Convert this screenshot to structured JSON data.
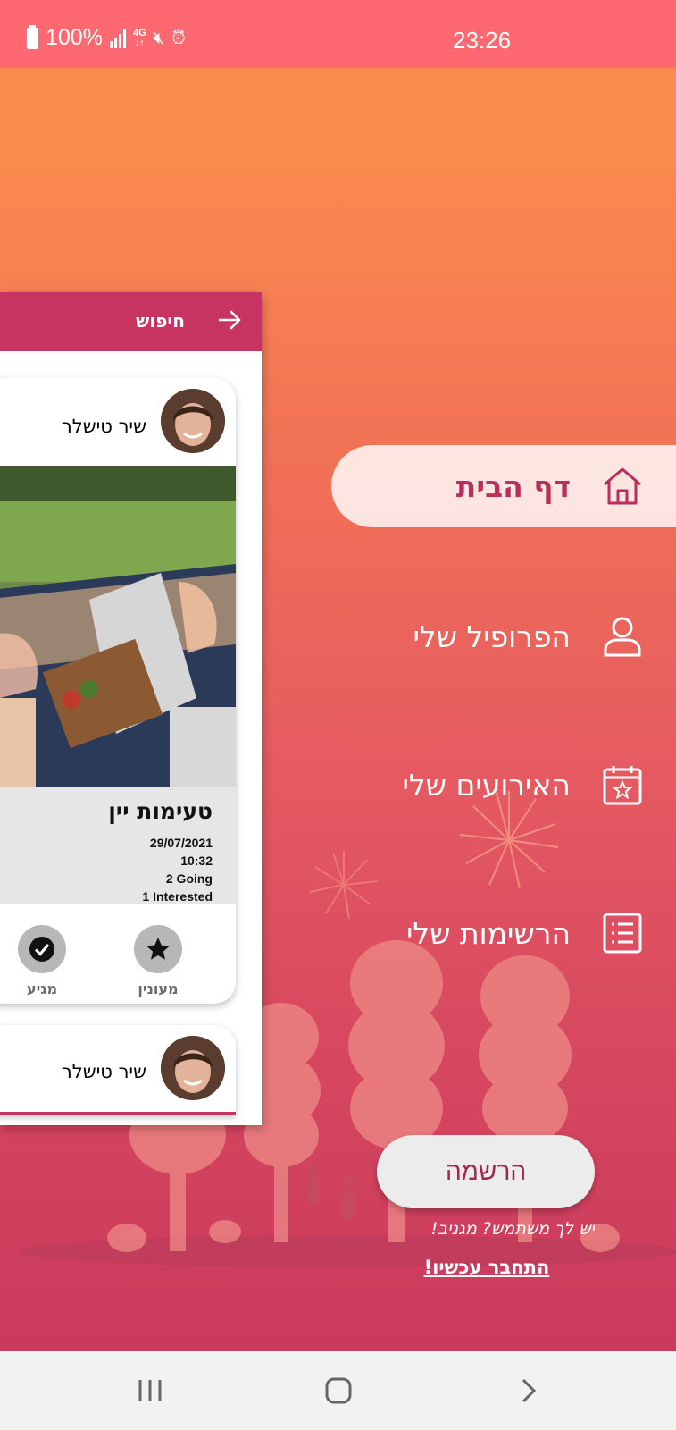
{
  "status_bar": {
    "battery": "100%",
    "time": "23:26",
    "network": "4G"
  },
  "menu": {
    "items": [
      {
        "label": "דף הבית",
        "icon": "home-icon",
        "active": true
      },
      {
        "label": "הפרופיל שלי",
        "icon": "user-icon",
        "active": false
      },
      {
        "label": "האירועים שלי",
        "icon": "calendar-star-icon",
        "active": false
      },
      {
        "label": "הרשימות שלי",
        "icon": "list-icon",
        "active": false
      }
    ],
    "register_label": "הרשמה",
    "has_user_text": "יש לך משתמש? מגניב!",
    "connect_label": "התחבר עכשיו!"
  },
  "main_panel": {
    "header_title": "חיפוש",
    "posts": [
      {
        "author": "שיר טישלר",
        "event_title": "טעימות יין",
        "date": "29/07/2021",
        "time": "10:32",
        "going": "2 Going",
        "interested": "1 Interested",
        "interested_label": "מעונין",
        "going_label": "מגיע"
      },
      {
        "author": "שיר טישלר"
      }
    ]
  },
  "colors": {
    "status_bar": "#fe6870",
    "header": "#c83462",
    "accent_text": "#b92e5a",
    "gradient_top": "#fb8a4e",
    "gradient_bottom": "#c93a5d"
  }
}
